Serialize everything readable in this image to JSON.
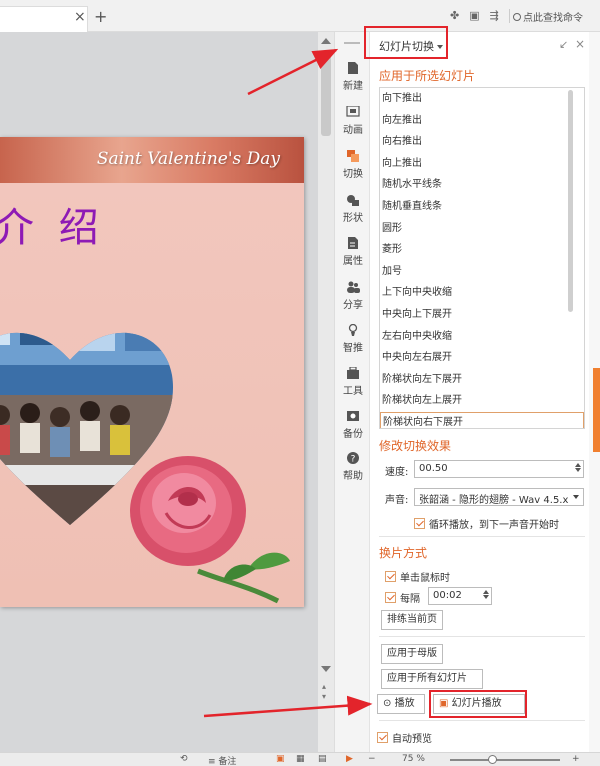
{
  "topbar": {
    "tab_close": "×",
    "tab_new": "+",
    "search_label": "点此查找命令"
  },
  "slide": {
    "banner_text": "Saint Valentine's Day",
    "title": "介 绍"
  },
  "sidebar": {
    "items": [
      {
        "label": "新建",
        "icon": "new-icon"
      },
      {
        "label": "动画",
        "icon": "animation-icon"
      },
      {
        "label": "切换",
        "icon": "transition-icon"
      },
      {
        "label": "形状",
        "icon": "shape-icon"
      },
      {
        "label": "属性",
        "icon": "property-icon"
      },
      {
        "label": "分享",
        "icon": "share-icon"
      },
      {
        "label": "智推",
        "icon": "smart-icon"
      },
      {
        "label": "工具",
        "icon": "tools-icon"
      },
      {
        "label": "备份",
        "icon": "backup-icon"
      },
      {
        "label": "帮助",
        "icon": "help-icon"
      }
    ]
  },
  "pane": {
    "title": "幻灯片切换",
    "apply_section": "应用于所选幻灯片",
    "transitions": [
      "向下推出",
      "向左推出",
      "向右推出",
      "向上推出",
      "随机水平线条",
      "随机垂直线条",
      "圆形",
      "菱形",
      "加号",
      "上下向中央收缩",
      "中央向上下展开",
      "左右向中央收缩",
      "中央向左右展开",
      "阶梯状向左下展开",
      "阶梯状向左上展开",
      "阶梯状向右下展开"
    ],
    "selected_transition": "阶梯状向右下展开",
    "modify_section": "修改切换效果",
    "speed_label": "速度:",
    "speed_value": "00.50",
    "sound_label": "声音:",
    "sound_value": "张韶涵 - 隐形的翅膀 - Wav 4.5.x",
    "loop_label": "循环播放，到下一声音开始时",
    "advance_section": "换片方式",
    "on_click_label": "单击鼠标时",
    "every_label": "每隔",
    "every_value": "00:02",
    "rehearse_button": "排练当前页",
    "apply_master_button": "应用于母版",
    "apply_all_button": "应用于所有幻灯片",
    "play_button": "播放",
    "slideshow_button": "幻灯片播放",
    "auto_preview_label": "自动预览"
  },
  "statusbar": {
    "notes_label": "备注",
    "zoom": "75 %"
  },
  "colors": {
    "accent": "#e0662a",
    "annotation": "#e3242b",
    "title_purple": "#8e1ab5"
  }
}
